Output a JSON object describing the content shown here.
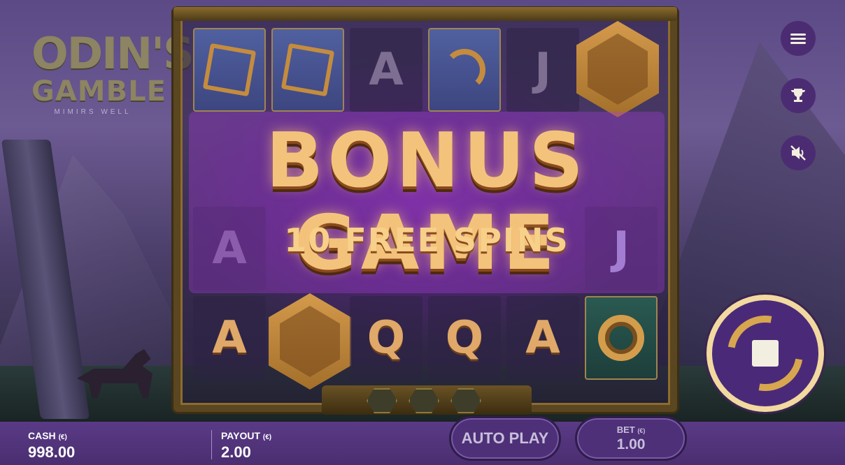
{
  "logo": {
    "line1": "ODIN'S",
    "line2": "GAMBLE",
    "line3": "MIMIRS WELL"
  },
  "bonus": {
    "title": "BONUS GAME",
    "subtitle": "10 FREE SPINS"
  },
  "reels": {
    "letters": [
      "A",
      "J",
      "A",
      "J",
      "A",
      "Q",
      "Q",
      "A"
    ]
  },
  "side_menu": {
    "menu_icon": "hamburger-menu-icon",
    "trophy_icon": "trophy-icon",
    "sound_icon": "sound-muted-icon"
  },
  "spin_button": {
    "icon": "stop-spin-icon"
  },
  "bottom_bar": {
    "cash_label": "CASH",
    "cash_currency": "(€)",
    "cash_value": "998.00",
    "payout_label": "PAYOUT",
    "payout_currency": "(€)",
    "payout_value": "2.00",
    "autoplay_label": "AUTO PLAY",
    "bet_label": "BET",
    "bet_currency": "(€)",
    "bet_value": "1.00"
  },
  "colors": {
    "bar_bg": "#4a2e70",
    "accent_gold": "#f3c37c",
    "bonus_glow": "#c83cff"
  }
}
